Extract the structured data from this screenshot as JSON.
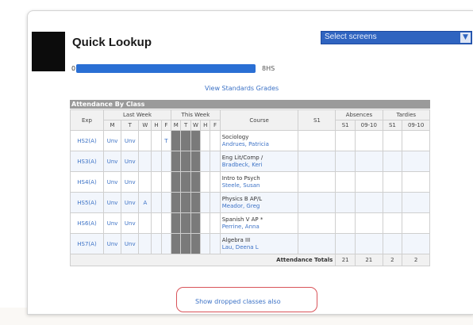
{
  "header": {
    "title": "Quick Lookup",
    "select_label": "Select screens"
  },
  "progress": {
    "start_label": "0",
    "end_label": "8HS",
    "fill_fraction": 1.0
  },
  "links": {
    "view_standards": "View Standards Grades",
    "show_dropped": "Show dropped classes also"
  },
  "attendance": {
    "title": "Attendance By Class",
    "headers": {
      "exp": "Exp",
      "last_week": "Last Week",
      "this_week": "This Week",
      "course": "Course",
      "st": "S1",
      "absences": "Absences",
      "tardies": "Tardies"
    },
    "days": [
      "M",
      "T",
      "W",
      "H",
      "F"
    ],
    "term_cols": [
      "S1",
      "09-10",
      "S1",
      "09-10"
    ],
    "rows": [
      {
        "exp": "HS2(A)",
        "lw": [
          "Unv",
          "Unv",
          "",
          "",
          "T"
        ],
        "course": "Sociology",
        "teacher": "Andrues, Patricia"
      },
      {
        "exp": "HS3(A)",
        "lw": [
          "Unv",
          "Unv",
          "",
          "",
          ""
        ],
        "course": "Eng Lit/Comp /",
        "teacher": "Bradbeck, Keri"
      },
      {
        "exp": "HS4(A)",
        "lw": [
          "Unv",
          "Unv",
          "",
          "",
          ""
        ],
        "course": "Intro to Psych",
        "teacher": "Steele, Susan"
      },
      {
        "exp": "HS5(A)",
        "lw": [
          "Unv",
          "Unv",
          "A",
          "",
          ""
        ],
        "course": "Physics B AP/L",
        "teacher": "Meador, Greg"
      },
      {
        "exp": "HS6(A)",
        "lw": [
          "Unv",
          "Unv",
          "",
          "",
          ""
        ],
        "course": "Spanish V AP *",
        "teacher": "Perrine, Anna"
      },
      {
        "exp": "HS7(A)",
        "lw": [
          "Unv",
          "Unv",
          "",
          "",
          ""
        ],
        "course": "Algebra III",
        "teacher": "Lau, Deena L"
      }
    ],
    "totals": {
      "label": "Attendance Totals",
      "values": [
        "21",
        "21",
        "2",
        "2"
      ]
    }
  }
}
